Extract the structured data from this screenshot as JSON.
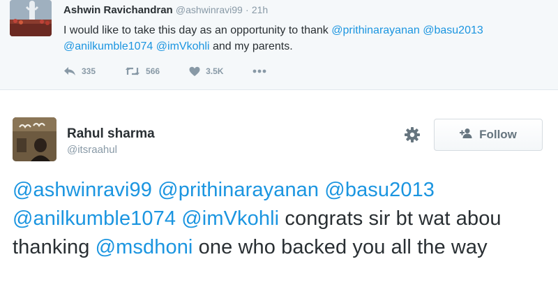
{
  "top_tweet": {
    "name": "Ashwin Ravichandran",
    "handle": "@ashwinravi99",
    "separator": "·",
    "time": "21h",
    "text_line1_plain": "I would like to take this day as an opportunity to thank",
    "mention_prithi": "@prithinarayanan",
    "mention_basu": "@basu2013",
    "mention_kumble": "@anilkumble1074",
    "mention_kohli": "@imVkohli",
    "text_tail": "and my parents.",
    "actions": {
      "reply_count": "335",
      "retweet_count": "566",
      "like_count": "3.5K"
    }
  },
  "main_tweet": {
    "name": "Rahul sharma",
    "handle": "@itsraahul",
    "follow_label": "Follow",
    "body": {
      "m1": "@ashwinravi99",
      "m2": "@prithinarayanan",
      "m3": "@basu2013",
      "m4": "@anilkumble1074",
      "m5": "@imVkohli",
      "t1": "congrats sir bt wat abou thanking",
      "m6": "@msdhoni",
      "t2": "one who backed you all the way"
    }
  },
  "colors": {
    "mention": "#1b95e0",
    "text": "#292f33",
    "muted": "#8899a6",
    "top_bg": "#f5f8fa",
    "button_text": "#66757f"
  },
  "icons": [
    "reply-icon",
    "retweet-icon",
    "heart-icon",
    "more-icon",
    "gear-icon",
    "add-user-icon"
  ]
}
